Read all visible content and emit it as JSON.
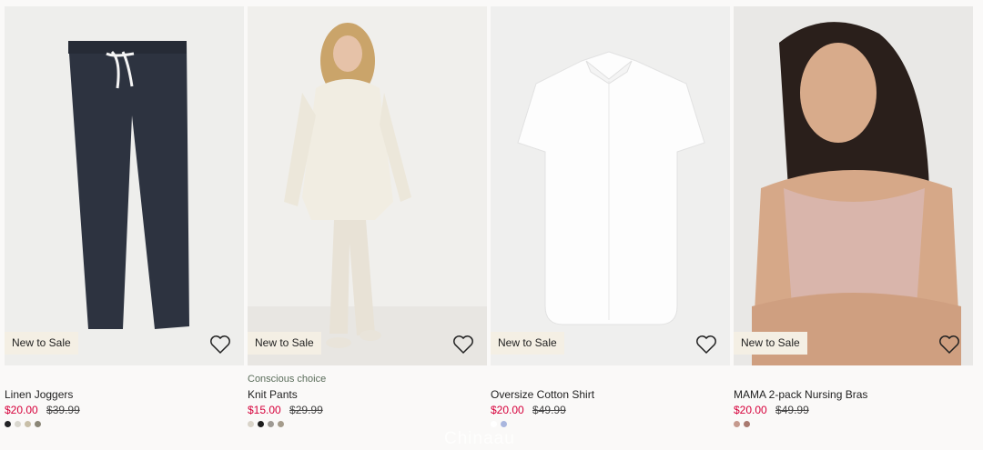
{
  "products": [
    {
      "badge": "New to Sale",
      "tagline": "",
      "name": "Linen Joggers",
      "price_sale": "$20.00",
      "price_old": "$39.99",
      "image_icon": "linen-joggers-photo",
      "swatches": [
        "#222326",
        "#d9d7cf",
        "#c8bfa8",
        "#8a8677"
      ]
    },
    {
      "badge": "New to Sale",
      "tagline": "Conscious choice",
      "name": "Knit Pants",
      "price_sale": "$15.00",
      "price_old": "$29.99",
      "image_icon": "knit-pants-photo",
      "swatches": [
        "#d9d4c9",
        "#1c1c1c",
        "#9e9a94",
        "#a59c8c"
      ]
    },
    {
      "badge": "New to Sale",
      "tagline": "",
      "name": "Oversize Cotton Shirt",
      "price_sale": "$20.00",
      "price_old": "$49.99",
      "image_icon": "cotton-shirt-photo",
      "swatches": [
        "#ffffff",
        "#a9b6de"
      ]
    },
    {
      "badge": "New to Sale",
      "tagline": "",
      "name": "MAMA 2-pack Nursing Bras",
      "price_sale": "$20.00",
      "price_old": "$49.99",
      "image_icon": "nursing-bras-photo",
      "swatches": [
        "#c59a8e",
        "#a97a70"
      ]
    }
  ],
  "watermark": "Chinaau",
  "colors": {
    "sale": "#d6003b",
    "badge_bg": "#f4efe4",
    "page_bg": "#faf9f8"
  },
  "favorite_icon": "heart-outline-icon"
}
